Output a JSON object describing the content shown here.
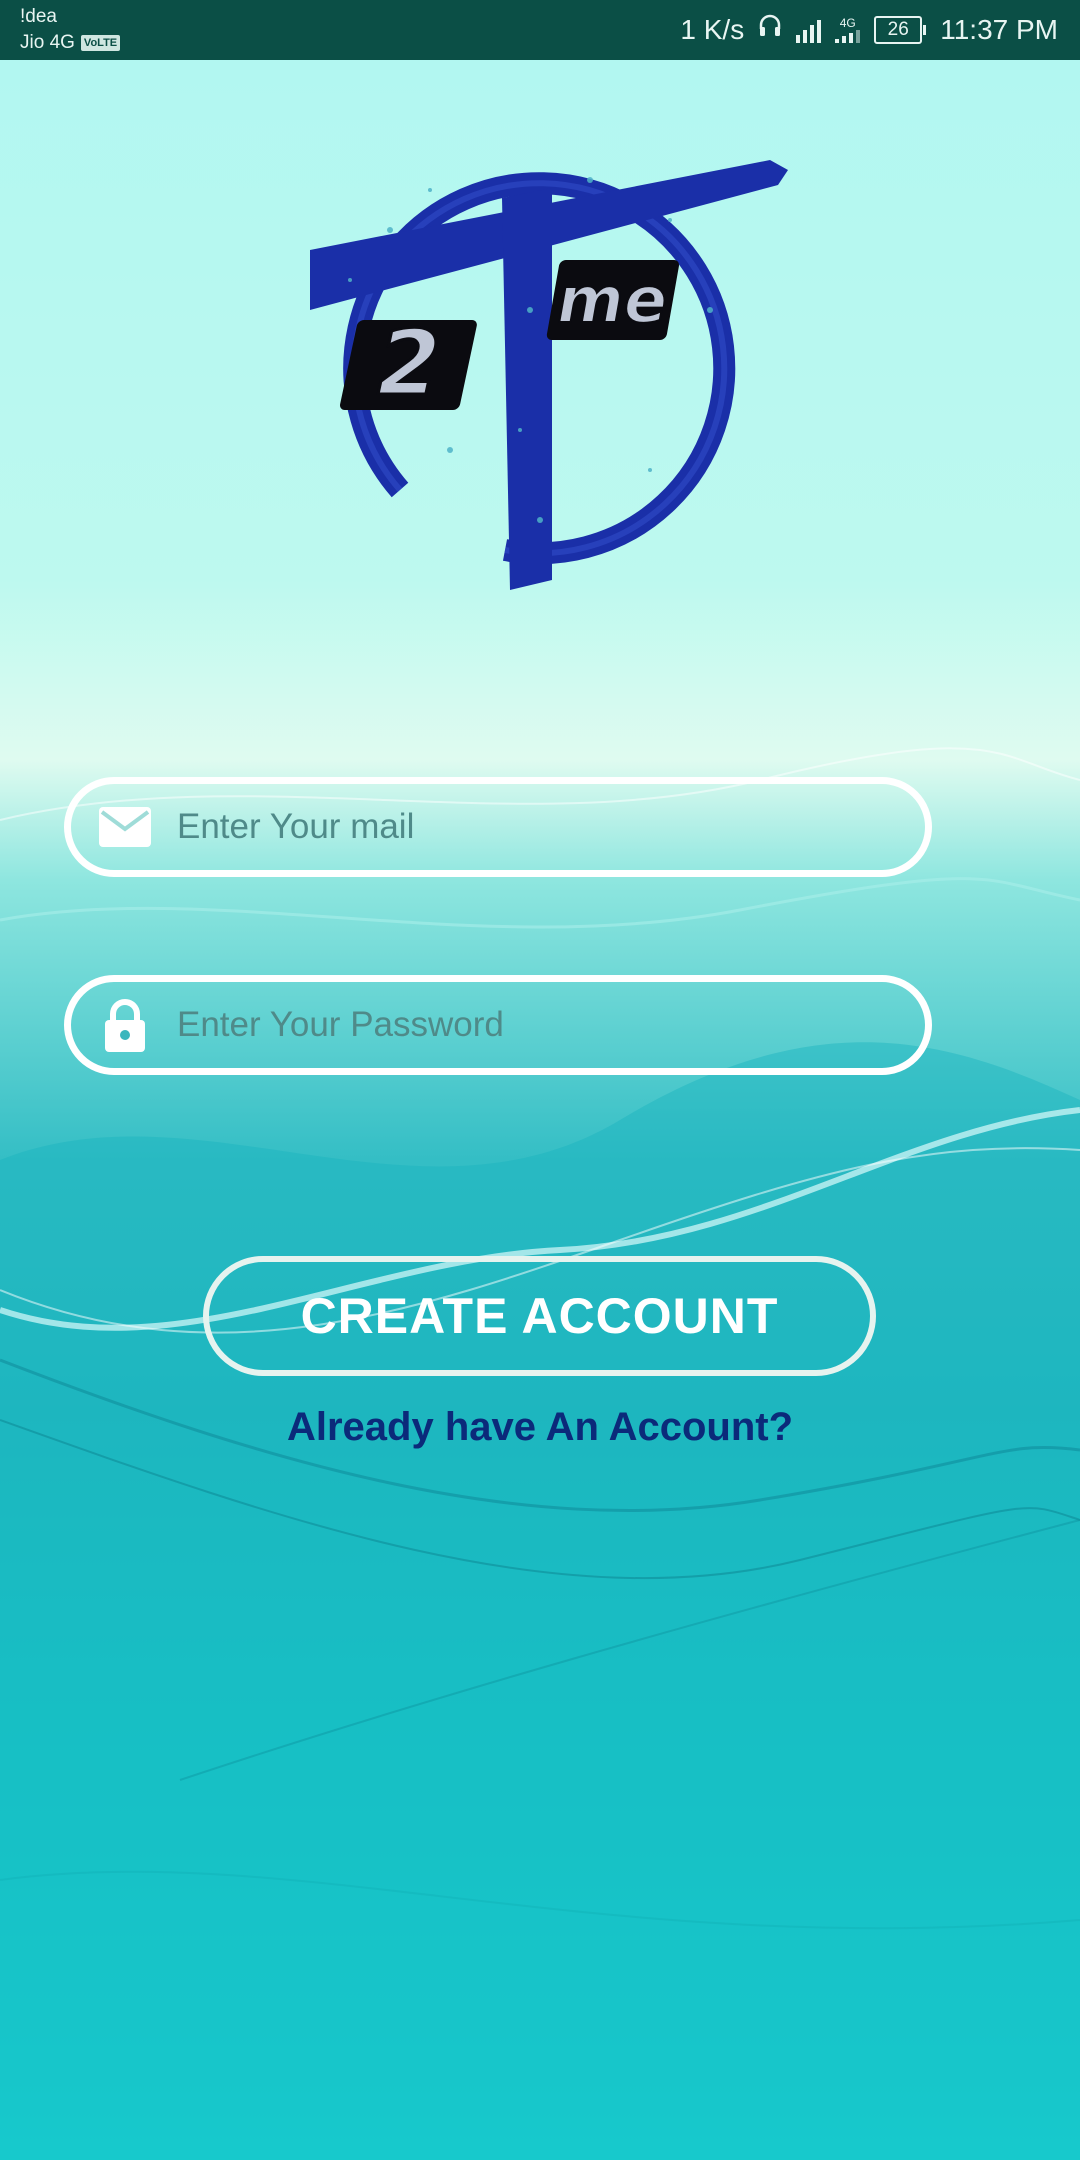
{
  "status_bar": {
    "carrier_1": "!dea",
    "carrier_2": "Jio 4G",
    "volte_badge": "VoLTE",
    "net_speed": "1 K/s",
    "network_type": "4G",
    "battery_level": "26",
    "time": "11:37 PM",
    "icons": [
      "headphones-icon",
      "signal-icon",
      "battery-icon"
    ]
  },
  "logo": {
    "label": "2Tme"
  },
  "form": {
    "email_placeholder": "Enter Your mail",
    "email_value": "",
    "password_placeholder": "Enter Your Password",
    "password_value": "",
    "create_account_label": "CREATE ACCOUNT",
    "login_link_label": "Already have An Account?"
  },
  "colors": {
    "status_bar_bg": "#0b4f46",
    "link_color": "#0b2a7a",
    "logo_blue": "#1a2fa8",
    "pill_border": "#ffffff"
  }
}
